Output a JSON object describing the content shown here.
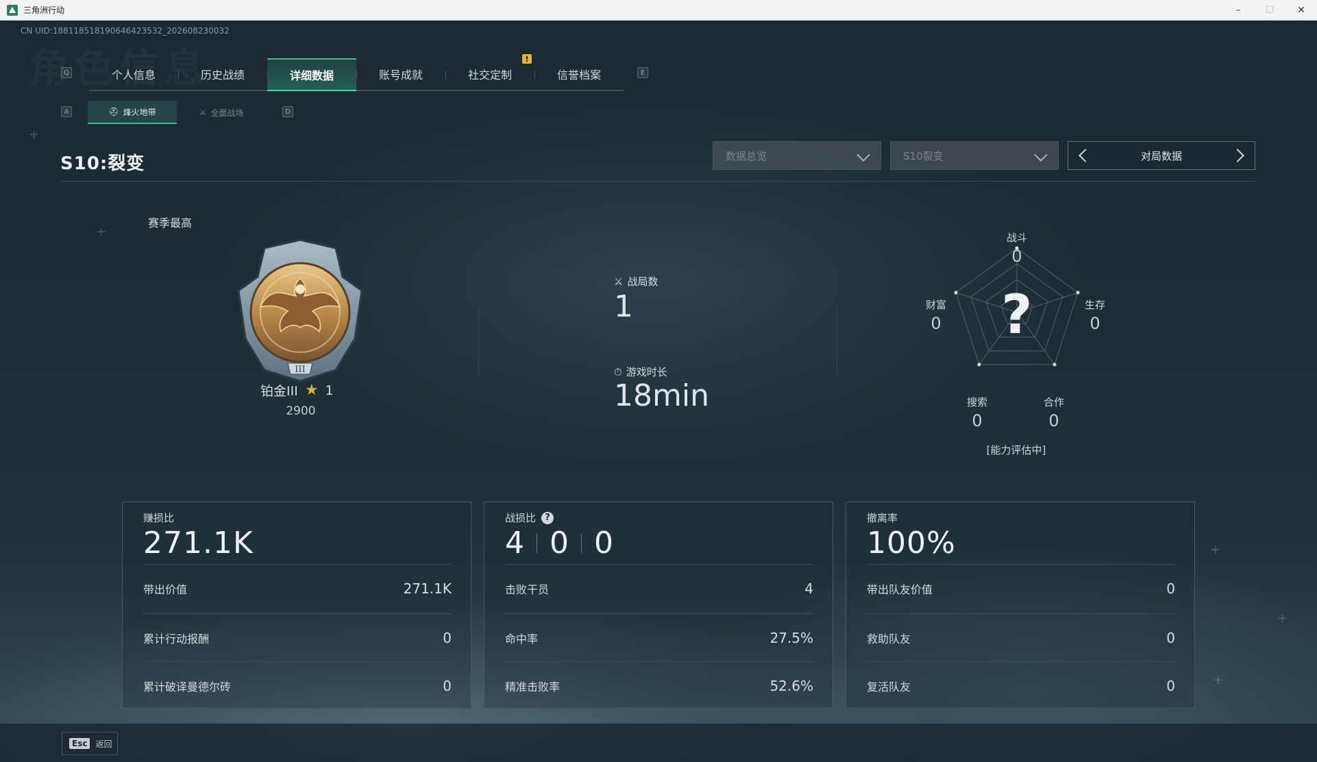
{
  "window": {
    "title": "三角洲行动",
    "controls": {
      "minimize": "–",
      "maximize": "☐",
      "close": "✕"
    }
  },
  "uid": "CN UID:18811851819064642353​2_202608230032",
  "ghost_title": "角色信息",
  "key_hints": {
    "prev_tab": "Q",
    "next_tab": "E",
    "prev_sub": "A",
    "next_sub": "D"
  },
  "tabs": [
    {
      "label": "个人信息",
      "active": false
    },
    {
      "label": "历史战绩",
      "active": false
    },
    {
      "label": "详细数据",
      "active": true
    },
    {
      "label": "账号成就",
      "active": false
    },
    {
      "label": "社交定制",
      "active": false
    },
    {
      "label": "信誉档案",
      "active": false
    }
  ],
  "notice_badge": "!",
  "subtabs": [
    {
      "label": "烽火地带",
      "icon": "helmet-icon",
      "active": true
    },
    {
      "label": "全面战场",
      "icon": "rifle-icon",
      "active": false
    }
  ],
  "season": {
    "title": "S10:裂变"
  },
  "filters": {
    "overview": "数据总览",
    "season": "S10裂变",
    "pager_label": "对局数据"
  },
  "rank": {
    "label": "赛季最高",
    "name": "铂金III",
    "stars": "1",
    "points": "2900",
    "medal_tier": "III"
  },
  "center_stats": {
    "matches_label": "战局数",
    "matches_value": "1",
    "playtime_label": "游戏时长",
    "playtime_value": "18min"
  },
  "radar": {
    "center_mark": "?",
    "axes": [
      {
        "label": "战斗",
        "value": "0"
      },
      {
        "label": "生存",
        "value": "0"
      },
      {
        "label": "合作",
        "value": "0"
      },
      {
        "label": "搜索",
        "value": "0"
      },
      {
        "label": "财富",
        "value": "0"
      }
    ],
    "note": "[能力评估中]"
  },
  "cards": [
    {
      "title": "赚损比",
      "big": "271.1K",
      "rows": [
        {
          "label": "带出价值",
          "value": "271.1K"
        },
        {
          "label": "累计行动报酬",
          "value": "0"
        },
        {
          "label": "累计破译曼德尔砖",
          "value": "0"
        }
      ]
    },
    {
      "title": "战损比",
      "kd": [
        "4",
        "0",
        "0"
      ],
      "rows": [
        {
          "label": "击败干员",
          "value": "4"
        },
        {
          "label": "命中率",
          "value": "27.5%"
        },
        {
          "label": "精准击败率",
          "value": "52.6%"
        }
      ]
    },
    {
      "title": "撤离率",
      "big": "100%",
      "rows": [
        {
          "label": "带出队友价值",
          "value": "0"
        },
        {
          "label": "救助队友",
          "value": "0"
        },
        {
          "label": "复活队友",
          "value": "0"
        }
      ]
    }
  ],
  "footer": {
    "esc_key": "Esc",
    "esc_label": "返回"
  },
  "colors": {
    "accent": "#3fbf93",
    "badge": "#e0b534",
    "gold": "#d8b04a"
  }
}
